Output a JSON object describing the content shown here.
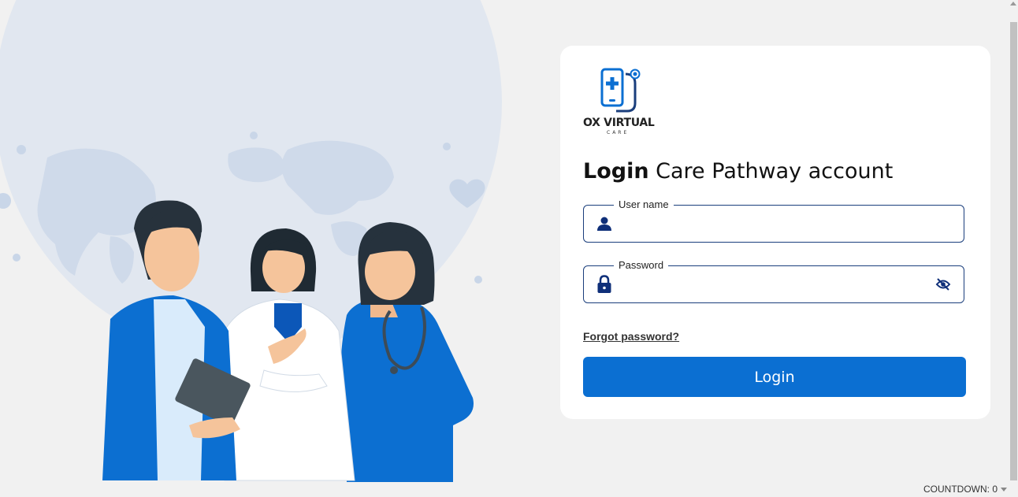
{
  "brand": {
    "name": "OX VIRTUAL",
    "tagline": "CARE",
    "accent_color": "#0b6fd2",
    "border_color": "#1a3e7c"
  },
  "heading": {
    "strong": "Login",
    "rest": " Care Pathway account"
  },
  "form": {
    "username": {
      "label": "User name",
      "value": "",
      "icon": "person-icon"
    },
    "password": {
      "label": "Password",
      "value": "",
      "icon": "lock-icon",
      "toggle_icon": "eye-slash-icon"
    },
    "forgot_label": "Forgot password?",
    "submit_label": "Login"
  },
  "footer": {
    "countdown_label": "COUNTDOWN: 0"
  },
  "illustration": {
    "subject": "doctors-illustration",
    "colors": {
      "globe": "#e1e7f0",
      "scrubs": "#1565c0",
      "coat": "#ffffff"
    }
  }
}
